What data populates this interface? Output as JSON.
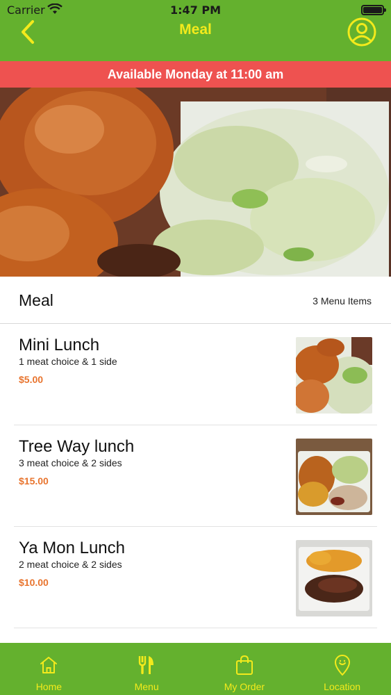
{
  "status_bar": {
    "carrier": "Carrier",
    "time": "1:47 PM"
  },
  "header": {
    "title": "Meal",
    "accent_color": "#f3ea1c",
    "background": "#64b12e"
  },
  "banner": {
    "text": "Available Monday at 11:00 am",
    "color": "#ee5250"
  },
  "hero": {
    "description_icon": "food-photo"
  },
  "section": {
    "title": "Meal",
    "count_label": "3 Menu Items"
  },
  "items": [
    {
      "name": "Mini Lunch",
      "description": "1 meat choice & 1 side",
      "price": "$5.00"
    },
    {
      "name": "Tree Way lunch",
      "description": "3 meat choice & 2 sides",
      "price": "$15.00"
    },
    {
      "name": "Ya Mon Lunch",
      "description": "2 meat choice & 2 sides",
      "price": "$10.00"
    }
  ],
  "tabbar": {
    "tabs": [
      {
        "label": "Home",
        "icon": "home-icon"
      },
      {
        "label": "Menu",
        "icon": "fork-knife-icon",
        "active": true
      },
      {
        "label": "My Order",
        "icon": "shopping-bag-icon"
      },
      {
        "label": "Location",
        "icon": "location-pin-icon"
      }
    ]
  }
}
